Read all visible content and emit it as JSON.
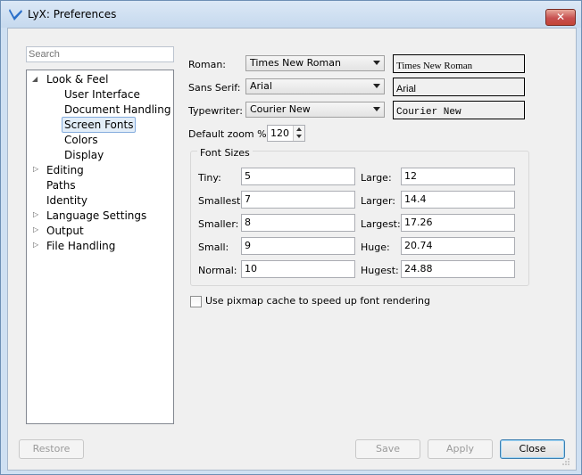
{
  "window": {
    "title": "LyX: Preferences",
    "close_glyph": "✕"
  },
  "sidebar": {
    "search_placeholder": "Search",
    "items": [
      {
        "label": "Look & Feel",
        "level": 0,
        "expanded": true
      },
      {
        "label": "User Interface",
        "level": 1
      },
      {
        "label": "Document Handling",
        "level": 1
      },
      {
        "label": "Screen Fonts",
        "level": 1,
        "selected": true
      },
      {
        "label": "Colors",
        "level": 1
      },
      {
        "label": "Display",
        "level": 1
      },
      {
        "label": "Editing",
        "level": 0,
        "collapsed": true
      },
      {
        "label": "Paths",
        "level": 0
      },
      {
        "label": "Identity",
        "level": 0
      },
      {
        "label": "Language Settings",
        "level": 0,
        "collapsed": true
      },
      {
        "label": "Output",
        "level": 0,
        "collapsed": true
      },
      {
        "label": "File Handling",
        "level": 0,
        "collapsed": true
      }
    ]
  },
  "fonts": {
    "roman_label": "Roman:",
    "roman_value": "Times New Roman",
    "roman_preview": "Times New Roman",
    "sans_label": "Sans Serif:",
    "sans_value": "Arial",
    "sans_preview": "Arial",
    "typewriter_label": "Typewriter:",
    "typewriter_value": "Courier New",
    "typewriter_preview": "Courier New",
    "zoom_label": "Default zoom %:",
    "zoom_value": "120"
  },
  "font_sizes": {
    "title": "Font Sizes",
    "tiny_label": "Tiny:",
    "tiny": "5",
    "smallest_label": "Smallest:",
    "smallest": "7",
    "smaller_label": "Smaller:",
    "smaller": "8",
    "small_label": "Small:",
    "small": "9",
    "normal_label": "Normal:",
    "normal": "10",
    "large_label": "Large:",
    "large": "12",
    "larger_label": "Larger:",
    "larger": "14.4",
    "largest_label": "Largest:",
    "largest": "17.26",
    "huge_label": "Huge:",
    "huge": "20.74",
    "hugest_label": "Hugest:",
    "hugest": "24.88"
  },
  "pixmap_cache": {
    "label": "Use pixmap cache to speed up font rendering",
    "checked": false
  },
  "buttons": {
    "restore": "Restore",
    "save": "Save",
    "apply": "Apply",
    "close": "Close"
  }
}
